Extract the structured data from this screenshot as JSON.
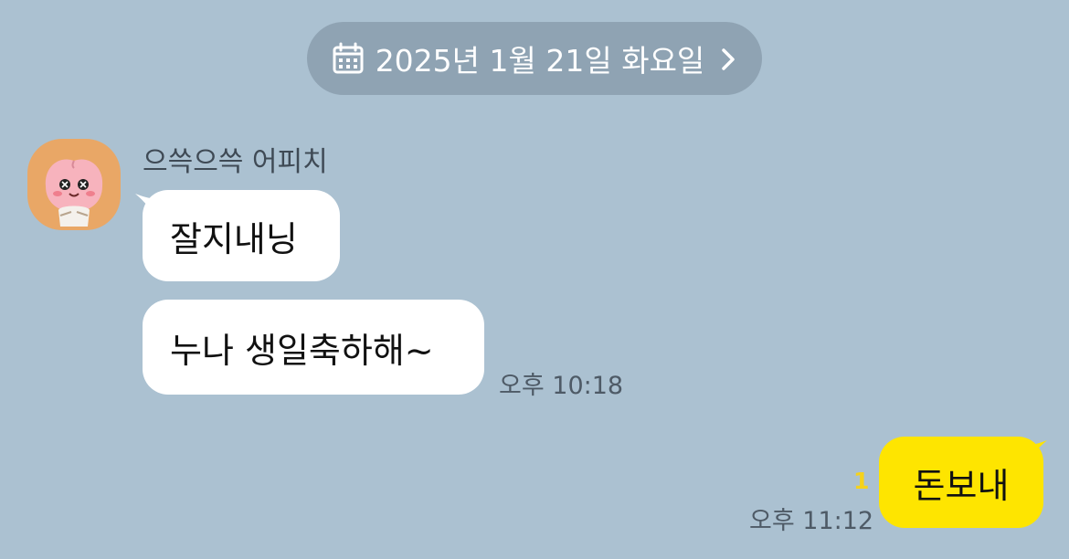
{
  "date_divider": {
    "label": "2025년 1월 21일 화요일",
    "icon": "calendar-icon",
    "chevron": "chevron-right-icon"
  },
  "received": {
    "sender_name": "으쓱으쓱 어피치",
    "avatar": "apeach-avatar",
    "messages": [
      {
        "text": "잘지내닝"
      },
      {
        "text": "누나 생일축하해~"
      }
    ],
    "time": "오후 10:18"
  },
  "sent": {
    "messages": [
      {
        "text": "돈보내"
      }
    ],
    "unread_count": "1",
    "time": "오후 11:12"
  },
  "colors": {
    "background": "#abc1d1",
    "date_pill": "#8fa3b3",
    "received_bubble": "#ffffff",
    "sent_bubble": "#fee500",
    "unread": "#f5d21b"
  }
}
